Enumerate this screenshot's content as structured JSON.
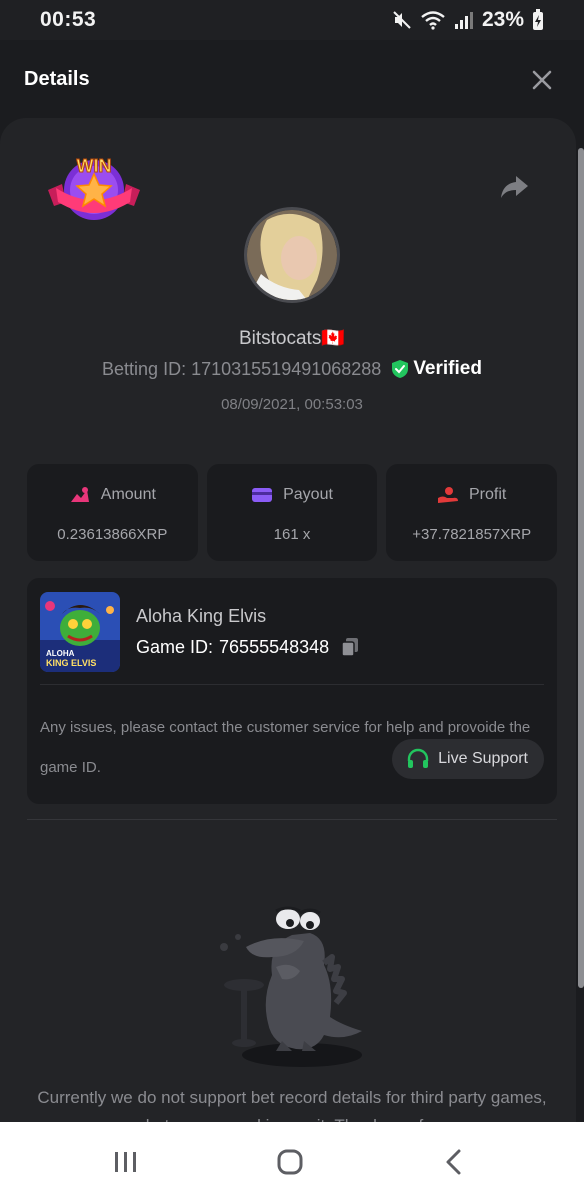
{
  "status_bar": {
    "time": "00:53",
    "battery": "23%"
  },
  "header": {
    "title": "Details"
  },
  "bet": {
    "username": "Bitstocats",
    "country_flag": "🇨🇦",
    "betting_id_label": "Betting ID:",
    "betting_id": "1710315519491068288",
    "verified_label": "Verified",
    "datetime": "08/09/2021, 00:53:03",
    "badge_text": "WIN"
  },
  "stats": [
    {
      "label": "Amount",
      "value": "0.23613866XRP",
      "icon": "amount-icon",
      "color": "#e8367a"
    },
    {
      "label": "Payout",
      "value": "161 x",
      "icon": "payout-card-icon",
      "color": "#8b5cf6"
    },
    {
      "label": "Profit",
      "value": "+37.7821857XRP",
      "icon": "profit-hand-icon",
      "color": "#e23a3a"
    }
  ],
  "game": {
    "name": "Aloha King Elvis",
    "id_label": "Game ID:",
    "id": "76555548348",
    "thumb_text_top": "ALOHA",
    "thumb_text_bottom": "KING ELVIS"
  },
  "support": {
    "notice": "Any issues, please contact the customer service for help and provoide the game ID.",
    "button_label": "Live Support"
  },
  "unsupported_message": "Currently we do not support bet record details for third party games, but we are working on it. Thank you for",
  "colors": {
    "background": "#1b1c1f",
    "card": "#232427",
    "verified_green": "#22c55e"
  }
}
